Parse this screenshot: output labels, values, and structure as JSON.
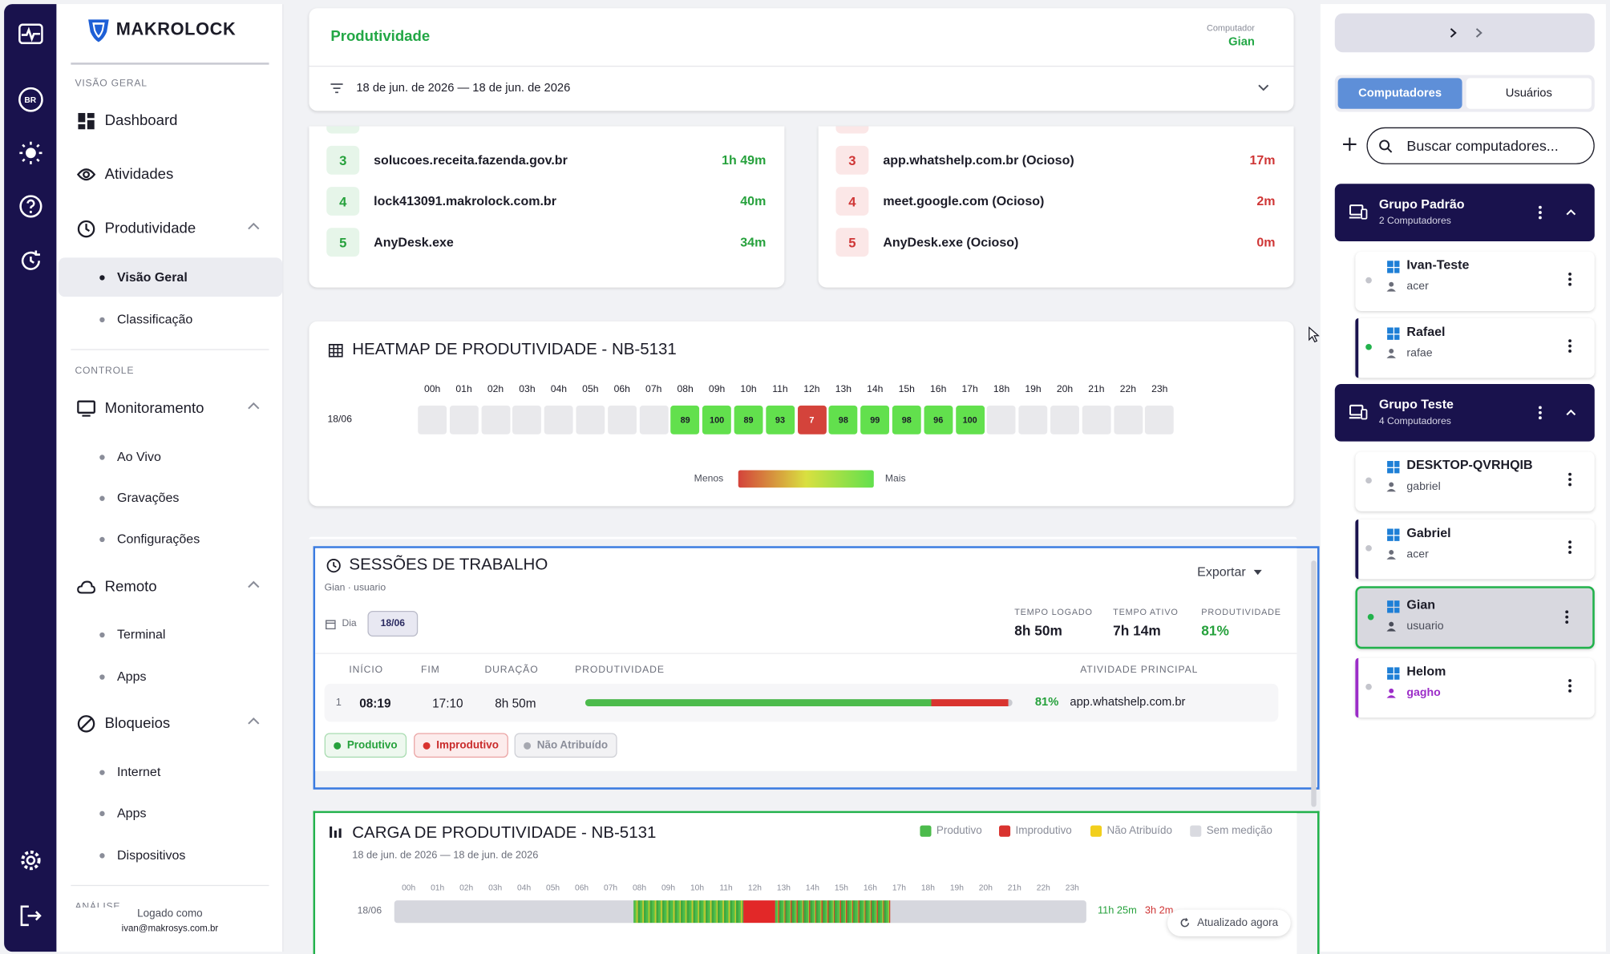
{
  "brand": {
    "name": "MAKROLOCK"
  },
  "rail": {
    "lang": "BR",
    "icons": [
      "activity-icon",
      "language-icon",
      "theme-icon",
      "help-icon",
      "refresh-icon",
      "settings-icon",
      "logout-icon"
    ]
  },
  "nav": {
    "section_overview": "VISÃO GERAL",
    "dashboard": "Dashboard",
    "atividades": "Atividades",
    "produtividade": "Produtividade",
    "visao_geral": "Visão Geral",
    "classificacao": "Classificação",
    "section_control": "CONTROLE",
    "monitoramento": "Monitoramento",
    "ao_vivo": "Ao Vivo",
    "gravacoes": "Gravações",
    "configuracoes": "Configurações",
    "remoto": "Remoto",
    "terminal": "Terminal",
    "apps_remoto": "Apps",
    "bloqueios": "Bloqueios",
    "internet": "Internet",
    "apps_bloqueios": "Apps",
    "dispositivos": "Dispositivos",
    "section_analysis": "ANÁLISE",
    "logged_label": "Logado como",
    "logged_user": "ivan@makrosys.com.br"
  },
  "header": {
    "title": "Produtividade",
    "computer_label": "Computador",
    "computer_value": "Gian",
    "date_range": "18 de jun. de 2026 — 18 de jun. de 2026"
  },
  "top_productive": [
    {
      "rank": "3",
      "name": "solucoes.receita.fazenda.gov.br",
      "value": "1h 49m"
    },
    {
      "rank": "4",
      "name": "lock413091.makrolock.com.br",
      "value": "40m"
    },
    {
      "rank": "5",
      "name": "AnyDesk.exe",
      "value": "34m"
    }
  ],
  "top_unproductive": [
    {
      "rank": "3",
      "name": "app.whatshelp.com.br (Ocioso)",
      "value": "17m"
    },
    {
      "rank": "4",
      "name": "meet.google.com (Ocioso)",
      "value": "2m"
    },
    {
      "rank": "5",
      "name": "AnyDesk.exe (Ocioso)",
      "value": "0m"
    }
  ],
  "heatmap": {
    "title": "HEATMAP DE PRODUTIVIDADE - NB-5131",
    "row_label": "18/06",
    "hours": [
      "00h",
      "01h",
      "02h",
      "03h",
      "04h",
      "05h",
      "06h",
      "07h",
      "08h",
      "09h",
      "10h",
      "11h",
      "12h",
      "13h",
      "14h",
      "15h",
      "16h",
      "17h",
      "18h",
      "19h",
      "20h",
      "21h",
      "22h",
      "23h"
    ],
    "values": [
      null,
      null,
      null,
      null,
      null,
      null,
      null,
      null,
      89,
      100,
      89,
      93,
      7,
      98,
      99,
      98,
      96,
      100,
      null,
      null,
      null,
      null,
      null,
      null
    ],
    "legend_less": "Menos",
    "legend_more": "Mais",
    "colors": {
      "empty": "#e9e9ec",
      "high": "#62e04d",
      "low": "#d4433b"
    }
  },
  "sessions": {
    "title": "SESSÕES DE TRABALHO",
    "subtitle": "Gian · usuario",
    "export_label": "Exportar",
    "day_label": "Dia",
    "day_value": "18/06",
    "stat_logged_label": "TEMPO LOGADO",
    "stat_logged_value": "8h 50m",
    "stat_active_label": "TEMPO ATIVO",
    "stat_active_value": "7h 14m",
    "stat_prod_label": "PRODUTIVIDADE",
    "stat_prod_value": "81%",
    "columns": [
      "INÍCIO",
      "FIM",
      "DURAÇÃO",
      "PRODUTIVIDADE",
      "ATIVIDADE PRINCIPAL"
    ],
    "row": {
      "index": "1",
      "start": "08:19",
      "end": "17:10",
      "duration": "8h 50m",
      "productive_fraction": 0.81,
      "unproductive_fraction": 0.18,
      "percent": "81%",
      "main_activity": "app.whatshelp.com.br"
    },
    "legend": {
      "produtivo": "Produtivo",
      "improdutivo": "Improdutivo",
      "nao_atribuido": "Não Atribuído"
    }
  },
  "load": {
    "title": "CARGA DE PRODUTIVIDADE - NB-5131",
    "date_range": "18 de jun. de 2026 — 18 de jun. de 2026",
    "legend": [
      "Produtivo",
      "Improdutivo",
      "Não Atribuído",
      "Sem medição"
    ],
    "row_label": "18/06",
    "hours": [
      "00h",
      "01h",
      "02h",
      "03h",
      "04h",
      "05h",
      "06h",
      "07h",
      "08h",
      "09h",
      "10h",
      "11h",
      "12h",
      "13h",
      "14h",
      "15h",
      "16h",
      "17h",
      "18h",
      "19h",
      "20h",
      "21h",
      "22h",
      "23h"
    ],
    "productive_total": "11h 25m",
    "unproductive_total": "3h 2m",
    "updated": "Atualizado agora"
  },
  "right": {
    "tab_computers": "Computadores",
    "tab_users": "Usuários",
    "search_placeholder": "Buscar computadores...",
    "groups": [
      {
        "name": "Grupo Padrão",
        "count": "2 Computadores",
        "pcs": [
          {
            "name": "Ivan-Teste",
            "user": "acer"
          },
          {
            "name": "Rafael",
            "user": "rafae"
          }
        ]
      },
      {
        "name": "Grupo Teste",
        "count": "4 Computadores",
        "pcs": [
          {
            "name": "DESKTOP-QVRHQIB",
            "user": "gabriel"
          },
          {
            "name": "Gabriel",
            "user": "acer"
          },
          {
            "name": "Gian",
            "user": "usuario"
          },
          {
            "name": "Helom",
            "user": "gagho"
          }
        ]
      }
    ]
  }
}
